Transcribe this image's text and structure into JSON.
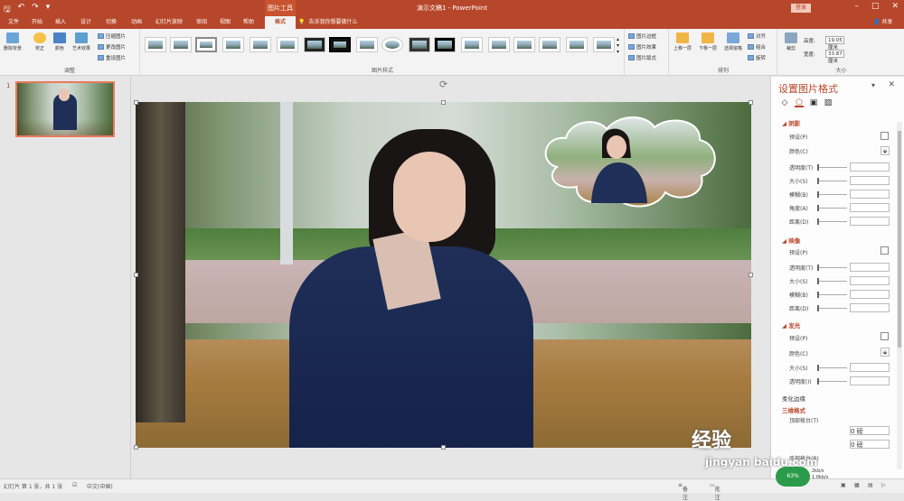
{
  "titlebar": {
    "context_tab": "图片工具",
    "doc_title": "演示文稿1 - PowerPoint",
    "login": "登录",
    "share": "共享",
    "tell_me": "告诉我你想要做什么"
  },
  "tabs": [
    {
      "label": "文件"
    },
    {
      "label": "开始"
    },
    {
      "label": "插入"
    },
    {
      "label": "设计"
    },
    {
      "label": "切换"
    },
    {
      "label": "动画"
    },
    {
      "label": "幻灯片放映"
    },
    {
      "label": "审阅"
    },
    {
      "label": "视图"
    },
    {
      "label": "帮助"
    },
    {
      "label": "格式"
    }
  ],
  "ribbon": {
    "adjust": {
      "remove_bg": "删除背景",
      "correct": "校正",
      "color": "颜色",
      "artistic": "艺术效果",
      "compress": "压缩图片",
      "change": "更改图片",
      "reset": "重设图片",
      "label": "调整"
    },
    "styles": {
      "label": "图片样式",
      "border": "图片边框",
      "effects": "图片效果",
      "layout": "图片版式"
    },
    "arrange": {
      "forward": "上移一层",
      "backward": "下移一层",
      "pane": "选择窗格",
      "align": "对齐",
      "group": "组合",
      "rotate": "旋转",
      "label": "排列"
    },
    "size": {
      "crop": "裁剪",
      "height_label": "高度:",
      "height": "19.05 厘米",
      "width_label": "宽度:",
      "width": "33.87 厘米",
      "label": "大小"
    }
  },
  "slides": {
    "number": "1"
  },
  "panel": {
    "title": "设置图片格式",
    "shadow": {
      "head": "阴影",
      "preset": "预设(P)",
      "color": "颜色(C)",
      "transparency": "透明度(T)",
      "size": "大小(S)",
      "blur": "模糊(B)",
      "angle": "角度(A)",
      "distance": "距离(D)"
    },
    "reflection": {
      "head": "映像",
      "preset": "预设(P)",
      "transparency": "透明度(T)",
      "size": "大小(S)",
      "blur": "模糊(B)",
      "distance": "距离(D)"
    },
    "glow": {
      "head": "发光",
      "preset": "预设(P)",
      "color": "颜色(C)",
      "size": "大小(S)",
      "transparency": "透明度(I)"
    },
    "soft_edges": "柔化边缘",
    "shape3d": "三维格式",
    "top_bevel": "顶部棱台(T)",
    "val1": "0 磅",
    "val2": "0 磅",
    "bottom": "底部棱台(B)"
  },
  "status": {
    "slide": "幻灯片 第 1 张，共 1 张",
    "lang": "中文(中国)",
    "notes": "备注",
    "comments": "批注"
  },
  "watermark": {
    "main": "经验",
    "sub": "jingyan",
    "host": "baidu.com"
  },
  "net": {
    "pct": "63%",
    "up": "2kb/s",
    "down": "1.0kb/s"
  },
  "colors": {
    "accent": "#b7472a"
  }
}
